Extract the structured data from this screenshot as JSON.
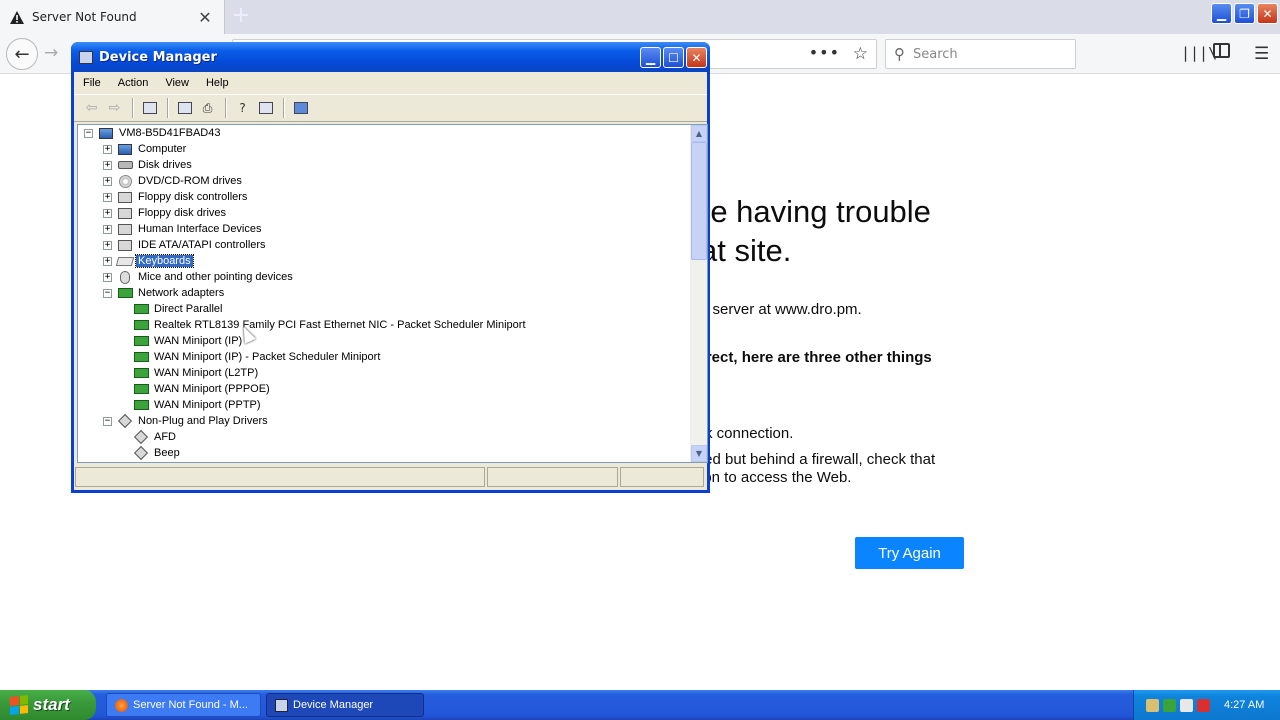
{
  "firefox": {
    "tab_title": "Server Not Found",
    "tab_close": "✕",
    "new_tab": "+",
    "search_placeholder": "Search",
    "page_actions": "•••",
    "error": {
      "heading_line1": "re having trouble",
      "heading_line2": "at site.",
      "server_line": "e server at www.dro.pm.",
      "bold_line": "rrect, here are three other things",
      "network_line": "rk connection.",
      "firewall_line1": "ted but behind a firewall, check that",
      "firewall_line2": "ion to access the Web.",
      "try_again": "Try Again"
    }
  },
  "device_manager": {
    "title": "Device Manager",
    "menu": [
      "File",
      "Action",
      "View",
      "Help"
    ],
    "tree": [
      {
        "label": "VM8-B5D41FBAD43",
        "level": 0,
        "expander": "−",
        "icon": "computer"
      },
      {
        "label": "Computer",
        "level": 1,
        "expander": "+",
        "icon": "computer"
      },
      {
        "label": "Disk drives",
        "level": 1,
        "expander": "+",
        "icon": "disk"
      },
      {
        "label": "DVD/CD-ROM drives",
        "level": 1,
        "expander": "+",
        "icon": "dvd"
      },
      {
        "label": "Floppy disk controllers",
        "level": 1,
        "expander": "+",
        "icon": "box"
      },
      {
        "label": "Floppy disk drives",
        "level": 1,
        "expander": "+",
        "icon": "box"
      },
      {
        "label": "Human Interface Devices",
        "level": 1,
        "expander": "+",
        "icon": "box"
      },
      {
        "label": "IDE ATA/ATAPI controllers",
        "level": 1,
        "expander": "+",
        "icon": "box"
      },
      {
        "label": "Keyboards",
        "level": 1,
        "expander": "+",
        "icon": "keyboard",
        "selected": true
      },
      {
        "label": "Mice and other pointing devices",
        "level": 1,
        "expander": "+",
        "icon": "mouse"
      },
      {
        "label": "Network adapters",
        "level": 1,
        "expander": "−",
        "icon": "net"
      },
      {
        "label": "Direct Parallel",
        "level": 2,
        "icon": "net"
      },
      {
        "label": "Realtek RTL8139 Family PCI Fast Ethernet NIC - Packet Scheduler Miniport",
        "level": 2,
        "icon": "net"
      },
      {
        "label": "WAN Miniport (IP)",
        "level": 2,
        "icon": "net"
      },
      {
        "label": "WAN Miniport (IP) - Packet Scheduler Miniport",
        "level": 2,
        "icon": "net"
      },
      {
        "label": "WAN Miniport (L2TP)",
        "level": 2,
        "icon": "net"
      },
      {
        "label": "WAN Miniport (PPPOE)",
        "level": 2,
        "icon": "net"
      },
      {
        "label": "WAN Miniport (PPTP)",
        "level": 2,
        "icon": "net"
      },
      {
        "label": "Non-Plug and Play Drivers",
        "level": 1,
        "expander": "−",
        "icon": "diamond"
      },
      {
        "label": "AFD",
        "level": 2,
        "icon": "diamond"
      },
      {
        "label": "Beep",
        "level": 2,
        "icon": "diamond"
      }
    ]
  },
  "taskbar": {
    "start": "start",
    "tasks": [
      "Server Not Found - M...",
      "Device Manager"
    ],
    "clock": "4:27 AM"
  },
  "colors": {
    "xp_titlebar": "#0548d8",
    "selection": "#316ac5",
    "try_again": "#0a84ff",
    "taskbar": "#245edc"
  }
}
